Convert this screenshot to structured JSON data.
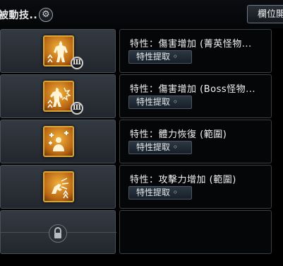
{
  "header": {
    "title": "被動技..",
    "slot_button_label": "欄位開"
  },
  "skills": [
    {
      "trait": "特性：傷害增加 (菁英怪物...",
      "extract_label": "特性提取",
      "rank": "Ⅲ",
      "icon": "elite-damage-icon"
    },
    {
      "trait": "特性：傷害增加 (Boss怪物...",
      "extract_label": "特性提取",
      "rank": "Ⅲ",
      "icon": "boss-damage-icon"
    },
    {
      "trait": "特性：體力恢復 (範圍)",
      "extract_label": "特性提取",
      "rank": "",
      "icon": "hp-recovery-icon"
    },
    {
      "trait": "特性：攻擊力增加 (範圍)",
      "extract_label": "特性提取",
      "rank": "",
      "icon": "attack-up-icon"
    }
  ],
  "locked_slot": {
    "icon": "lock-icon"
  },
  "colors": {
    "icon_gold": "#d8a63a",
    "panel": "#2a3038"
  }
}
